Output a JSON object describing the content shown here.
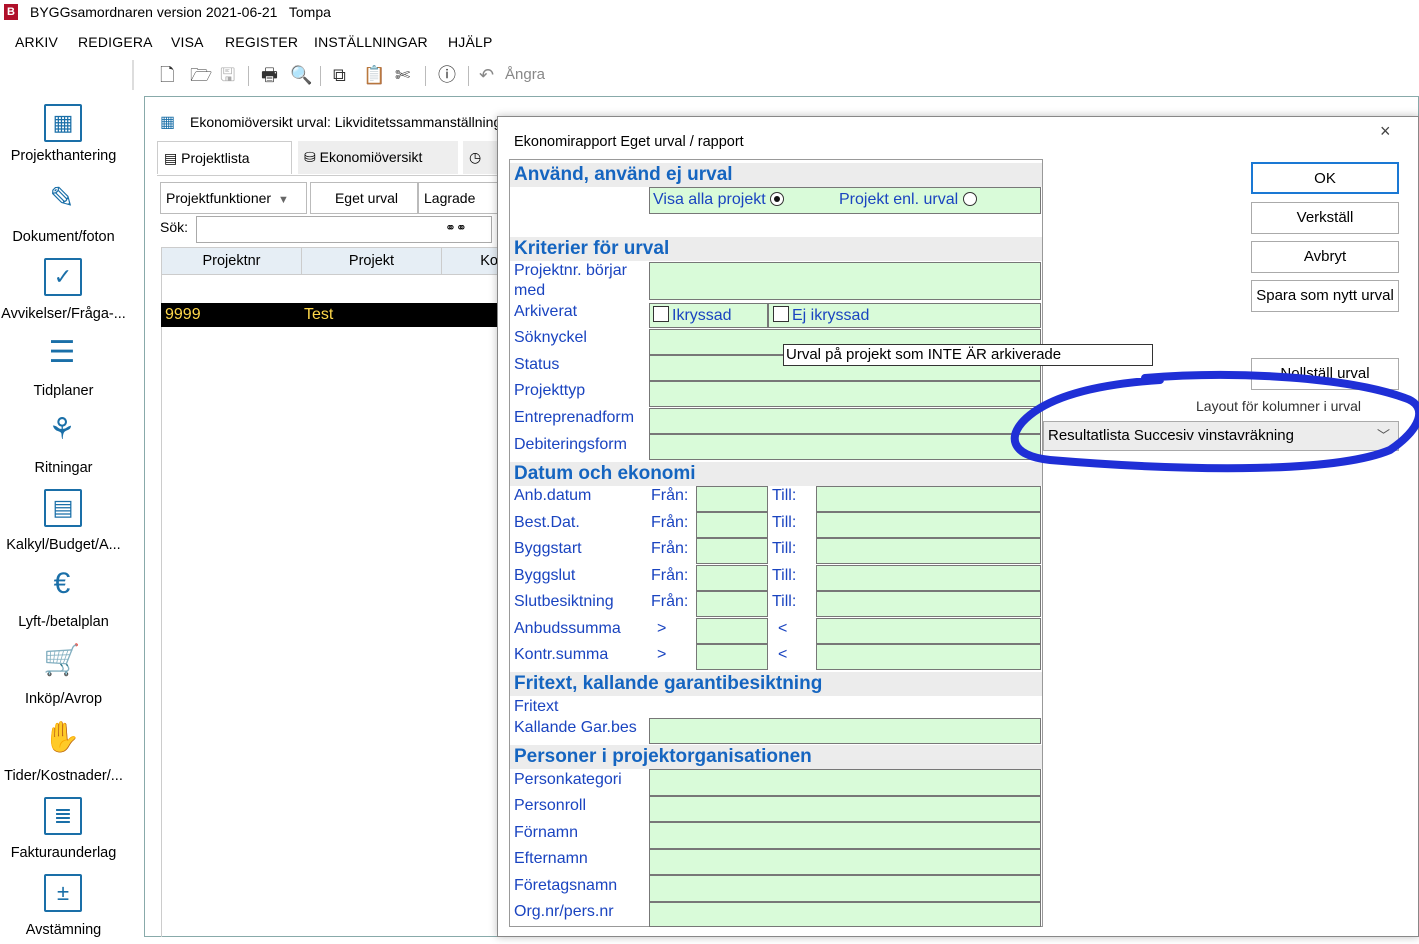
{
  "app": {
    "logo_text": "B",
    "title": "BYGGsamordnaren version 2021-06-21",
    "user": "Tompa"
  },
  "menu": [
    "ARKIV",
    "REDIGERA",
    "VISA",
    "REGISTER",
    "INSTÄLLNINGAR",
    "HJÄLP"
  ],
  "toolbar": {
    "undo_label": "Ångra",
    "icons": [
      "new-icon",
      "open-icon",
      "save-icon",
      "print-icon",
      "preview-icon",
      "copy-icon",
      "paste-icon",
      "cut-icon",
      "help-icon",
      "undo-icon"
    ]
  },
  "sidebar": {
    "items": [
      {
        "label": "Projekthantering",
        "icon": "project-icon"
      },
      {
        "label": "Dokument/foton",
        "icon": "document-edit-icon"
      },
      {
        "label": "Avvikelser/Fråga-...",
        "icon": "checkbox-icon"
      },
      {
        "label": "Tidplaner",
        "icon": "timeline-icon"
      },
      {
        "label": "Ritningar",
        "icon": "compass-icon"
      },
      {
        "label": "Kalkyl/Budget/A...",
        "icon": "calculator-icon"
      },
      {
        "label": "Lyft-/betalplan",
        "icon": "euro-icon"
      },
      {
        "label": "Inköp/Avrop",
        "icon": "cart-icon"
      },
      {
        "label": "Tider/Kostnader/...",
        "icon": "hand-coins-icon"
      },
      {
        "label": "Fakturaunderlag",
        "icon": "invoice-icon"
      },
      {
        "label": "Avstämning",
        "icon": "reconcile-icon"
      }
    ]
  },
  "main": {
    "title": "Ekonomiöversikt urval: Likviditetssammanställning",
    "tabs": {
      "projektlista": "Projektlista",
      "ekonomi": "Ekonomiöversikt"
    },
    "functions": {
      "projektfunktioner": "Projektfunktioner",
      "eget_urval": "Eget urval",
      "lagrade": "Lagrade"
    },
    "search_label": "Sök:",
    "columns": {
      "projektnr": "Projektnr",
      "projekt": "Projekt",
      "ko": "Ko"
    },
    "row": {
      "projektnr": "9999",
      "projekt": "Test"
    }
  },
  "dialog": {
    "title": "Ekonomirapport Eget urval / rapport",
    "close": "×",
    "sections": {
      "anvand": "Använd, använd ej urval",
      "kriterier": "Kriterier för urval",
      "datum": "Datum och ekonomi",
      "fritext": "Fritext, kallande garantibesiktning",
      "personer": "Personer i projektorganisationen"
    },
    "radio": {
      "visa_alla": "Visa alla projekt",
      "enl_urval": "Projekt enl. urval",
      "selected": "visa_alla"
    },
    "fields": {
      "projektnr_borjar": "Projektnr. börjar",
      "med": "med",
      "arkiverat": "Arkiverat",
      "ikryssad": "Ikryssad",
      "ej_ikryssad": "Ej ikryssad",
      "soknyckel": "Söknyckel",
      "status": "Status",
      "projekttyp": "Projekttyp",
      "entreprenadform": "Entreprenadform",
      "debiteringsform": "Debiteringsform",
      "fritext": "Fritext",
      "kallande": "Kallande Gar.bes",
      "personkategori": "Personkategori",
      "personroll": "Personroll",
      "fornamn": "Förnamn",
      "efternamn": "Efternamn",
      "foretagsnamn": "Företagsnamn",
      "orgnr": "Org.nr/pers.nr"
    },
    "date_rows": [
      {
        "label": "Anb.datum",
        "op1": "Från:",
        "op2": "Till:"
      },
      {
        "label": "Best.Dat.",
        "op1": "Från:",
        "op2": "Till:"
      },
      {
        "label": "Byggstart",
        "op1": "Från:",
        "op2": "Till:"
      },
      {
        "label": "Byggslut",
        "op1": "Från:",
        "op2": "Till:"
      },
      {
        "label": "Slutbesiktning",
        "op1": "Från:",
        "op2": "Till:"
      },
      {
        "label": "Anbudssumma",
        "op1": ">",
        "op2": "<"
      },
      {
        "label": "Kontr.summa",
        "op1": ">",
        "op2": "<"
      }
    ],
    "tooltip": "Urval på projekt som INTE ÄR arkiverade",
    "buttons": {
      "ok": "OK",
      "verkstall": "Verkställ",
      "avbryt": "Avbryt",
      "spara": "Spara som nytt urval",
      "nollstall": "Nollställ urval"
    },
    "layout_label": "Layout för kolumner i urval",
    "layout_value": "Resultatlista Succesiv vinstavräkning",
    "annotation_color": "#1f2fd6",
    "field_color": "#d9fbd9",
    "header_color": "#1565c0"
  }
}
